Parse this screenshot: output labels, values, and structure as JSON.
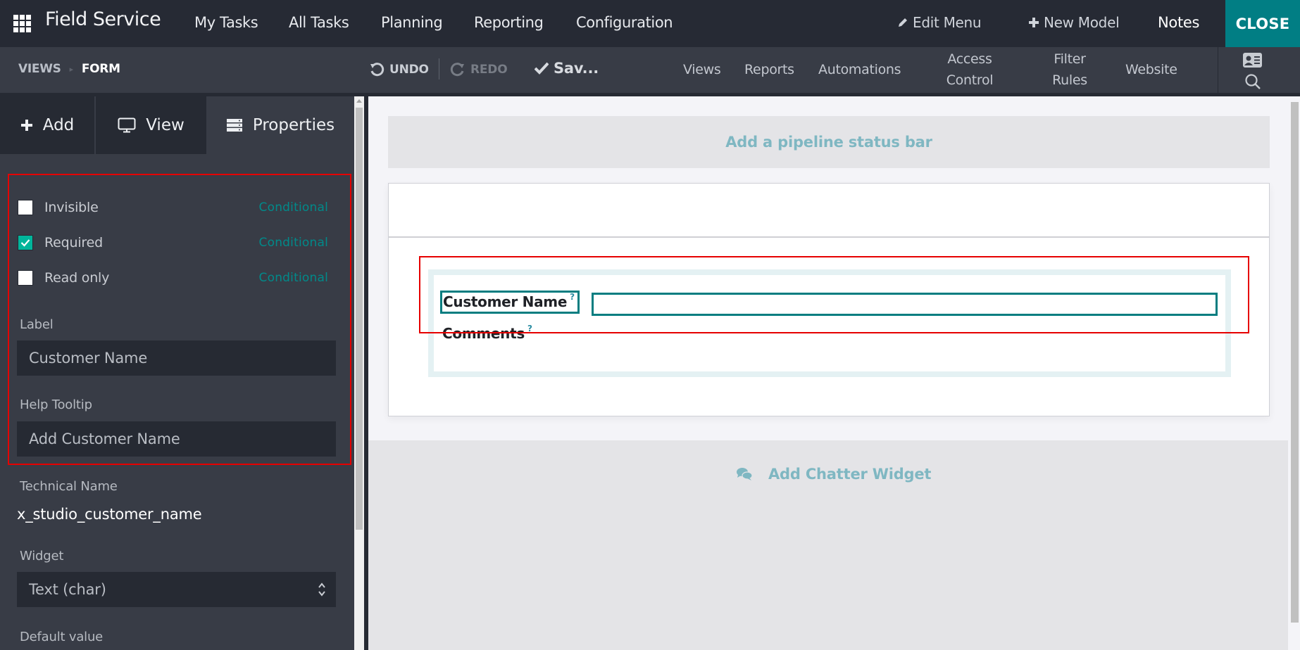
{
  "header": {
    "app_title": "Field Service",
    "menu": [
      "My Tasks",
      "All Tasks",
      "Planning",
      "Reporting",
      "Configuration"
    ],
    "edit_menu_label": "Edit Menu",
    "new_model_label": "New Model",
    "notes_label": "Notes",
    "close_label": "CLOSE",
    "icons": {
      "apps": "apps-grid-icon",
      "edit": "pencil-icon",
      "new": "plus-icon"
    }
  },
  "toolbar": {
    "breadcrumb": [
      "VIEWS",
      "FORM"
    ],
    "undo_label": "UNDO",
    "redo_label": "REDO",
    "save_label": "Sav...",
    "menu": [
      {
        "line1": "Views"
      },
      {
        "line1": "Reports"
      },
      {
        "line1": "Automations"
      },
      {
        "line1": "Access",
        "line2": "Control"
      },
      {
        "line1": "Filter",
        "line2": "Rules"
      },
      {
        "line1": "Website"
      }
    ],
    "icons": {
      "undo": "undo-icon",
      "redo": "redo-icon",
      "save": "check-icon",
      "card": "id-card-icon",
      "search": "search-icon"
    }
  },
  "sidebar": {
    "tabs": [
      {
        "label": "Add",
        "icon": "plus-icon"
      },
      {
        "label": "View",
        "icon": "monitor-icon"
      },
      {
        "label": "Properties",
        "icon": "server-icon",
        "active": true
      }
    ],
    "checkboxes": [
      {
        "label": "Invisible",
        "checked": false,
        "link": "Conditional"
      },
      {
        "label": "Required",
        "checked": true,
        "link": "Conditional"
      },
      {
        "label": "Read only",
        "checked": false,
        "link": "Conditional"
      }
    ],
    "label_field": {
      "label": "Label",
      "value": "Customer Name"
    },
    "tooltip_field": {
      "label": "Help Tooltip",
      "value": "Add Customer Name"
    },
    "technical_name": {
      "label": "Technical Name",
      "value": "x_studio_customer_name"
    },
    "widget": {
      "label": "Widget",
      "value": "Text (char)"
    },
    "default_value": {
      "label": "Default value"
    }
  },
  "main": {
    "pipeline_label": "Add a pipeline status bar",
    "fields": [
      {
        "label": "Customer Name",
        "help": "?"
      },
      {
        "label": "Comments",
        "help": "?"
      }
    ],
    "chatter_label": "Add Chatter Widget"
  },
  "colors": {
    "accent": "#017e84",
    "highlight_box": "#e60000",
    "checkbox_checked": "#00b59b",
    "hint_text": "#7fb7c2"
  }
}
